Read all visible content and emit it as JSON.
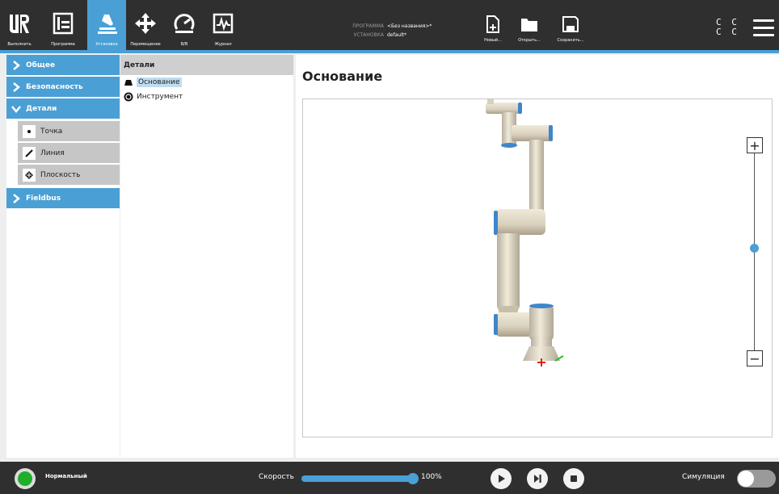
{
  "header": {
    "nav": [
      {
        "label": "Выполнить",
        "icon": "ur-logo-icon"
      },
      {
        "label": "Программа",
        "icon": "program-icon"
      },
      {
        "label": "Установка",
        "icon": "installation-icon",
        "active": true
      },
      {
        "label": "Перемещение",
        "icon": "move-icon"
      },
      {
        "label": "В/В",
        "icon": "io-icon"
      },
      {
        "label": "Журнал",
        "icon": "log-icon"
      }
    ],
    "program_key": "ПРОГРАММА",
    "program_value": "<Без названия>*",
    "install_key": "УСТАНОВКА",
    "install_value": "default*",
    "file_buttons": [
      {
        "label": "Новый...",
        "icon": "new-file-icon"
      },
      {
        "label": "Открыть...",
        "icon": "folder-icon"
      },
      {
        "label": "Сохранить...",
        "icon": "save-icon"
      }
    ],
    "cc_line1": "C C",
    "cc_line2": "C C",
    "menu_icon": "hamburger-menu-icon"
  },
  "leftnav": {
    "items": [
      {
        "label": "Общее"
      },
      {
        "label": "Безопасность"
      },
      {
        "label": "Детали"
      },
      {
        "label": "Fieldbus"
      }
    ],
    "subitems": [
      {
        "label": "Точка",
        "icon": "point-icon"
      },
      {
        "label": "Линия",
        "icon": "line-icon"
      },
      {
        "label": "Плоскость",
        "icon": "plane-icon"
      }
    ]
  },
  "tree": {
    "header": "Детали",
    "rows": [
      {
        "label": "Основание",
        "icon": "base-icon",
        "selected": true
      },
      {
        "label": "Инструмент",
        "icon": "tool-icon",
        "selected": false
      }
    ]
  },
  "main": {
    "title": "Основание",
    "zoom_plus": "+",
    "zoom_minus": "−",
    "zoom_level": 0.5
  },
  "footer": {
    "status": "Нормальный",
    "speed_label": "Скорость",
    "speed_value": "100%",
    "speed_fraction": 1.0,
    "sim_label": "Симуляция",
    "simulation_on": false
  },
  "colors": {
    "accent": "#4a9fd5",
    "header_bg": "#2f2f2f",
    "status_ok": "#1fae2a"
  }
}
